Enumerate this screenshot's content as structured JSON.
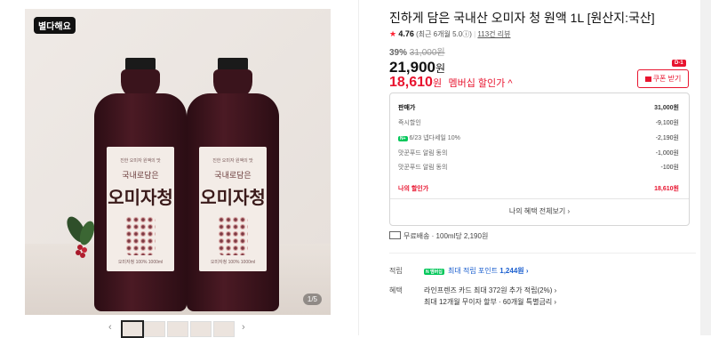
{
  "gallery": {
    "badge": "별다해요",
    "bottle_label_small": "진한 오미자 원액의 맛",
    "bottle_label_sub": "국내로담은",
    "bottle_label_main": "오미자청",
    "bottle_label_tiny": "오미자청 100%  1000ml",
    "counter": "1/5",
    "prev_arrow": "‹",
    "next_arrow": "›"
  },
  "product": {
    "title": "진하게 담은 국내산 오미자 청 원액 1L [원산지:국산]",
    "rating_score": "4.76",
    "rating_detail": "(최근 6개월 5.0ⓘ)",
    "reviews": "113건 리뷰",
    "discount_pct": "39%",
    "original_price": "31,000원",
    "price": "21,900",
    "price_unit": "원",
    "member_price": "18,610",
    "member_unit": "원",
    "member_label": "멤버십 할인가 ^",
    "coupon_label": "쿠폰 받기",
    "dday": "D-1"
  },
  "price_box": {
    "rows": [
      {
        "label": "판매가",
        "value": "31,000원"
      },
      {
        "label": "즉시할인",
        "value": "-9,100원"
      },
      {
        "label": "6/23 넵다세일 10%",
        "value": "-2,190원"
      },
      {
        "label": "맛꾼푸드 알림 동의",
        "value": "-1,000원"
      },
      {
        "label": "맛꾼푸드 알림 동의",
        "value": "-100원"
      },
      {
        "label": "나의 할인가",
        "value": "18,610원"
      }
    ],
    "more_link": "나의 혜택 전체보기 ›"
  },
  "delivery": {
    "text": "무료배송 · 100ml당 2,190원"
  },
  "benefits": {
    "point_label": "적립",
    "point_badge": "N 멤버십",
    "point_text": "최대 적립 포인트",
    "point_value": "1,244원 ›",
    "benefit_label": "혜택",
    "benefit_line1": "라인프렌즈 카드 최대 372원 추가 적립(2%) ›",
    "benefit_line2": "최대 12개월 무이자 할부 · 60개월 특별금리 ›"
  },
  "colors": {
    "accent_red": "#e8142f",
    "point_blue": "#1b5fcf",
    "naver_green": "#03c75a"
  }
}
